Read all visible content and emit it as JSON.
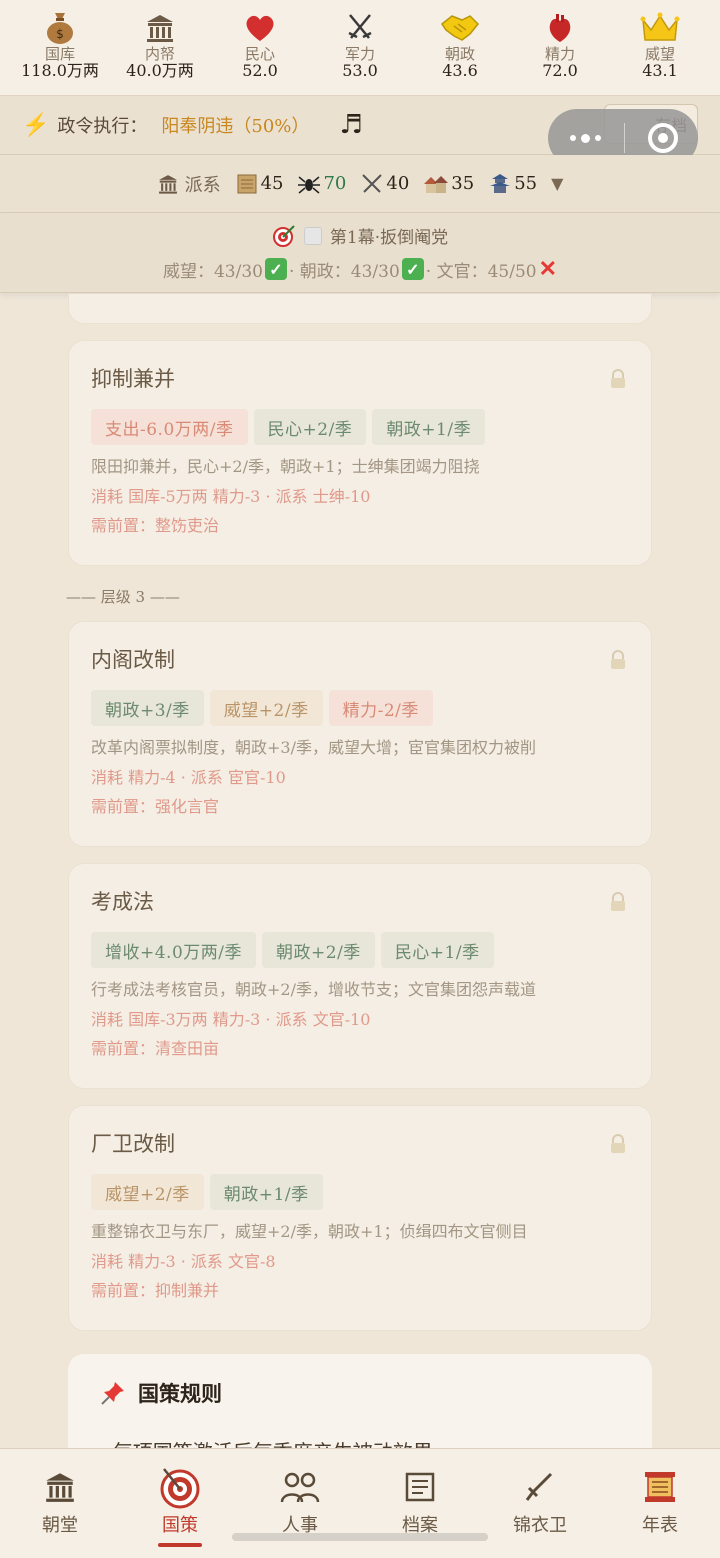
{
  "resources": [
    {
      "icon": "money-bag-icon",
      "label": "国库",
      "value": "118.0万两"
    },
    {
      "icon": "treasury-building-icon",
      "label": "内帑",
      "value": "40.0万两"
    },
    {
      "icon": "heart-icon",
      "label": "民心",
      "value": "52.0"
    },
    {
      "icon": "crossed-swords-icon",
      "label": "军力",
      "value": "53.0"
    },
    {
      "icon": "handshake-icon",
      "label": "朝政",
      "value": "43.6"
    },
    {
      "icon": "anatomical-heart-icon",
      "label": "精力",
      "value": "72.0"
    },
    {
      "icon": "crown-icon",
      "label": "威望",
      "value": "43.1"
    }
  ],
  "policy": {
    "label": "政令执行：",
    "value": "阳奉阴违（50%）",
    "save_label": "存档"
  },
  "factions": {
    "label": "派系",
    "items": [
      {
        "icon": "scroll-icon",
        "value": "45"
      },
      {
        "icon": "spider-icon",
        "value": "70"
      },
      {
        "icon": "crossed-swords-icon",
        "value": "40"
      },
      {
        "icon": "houses-icon",
        "value": "35"
      },
      {
        "icon": "pagoda-icon",
        "value": "55"
      }
    ],
    "toggle": "▼"
  },
  "act": {
    "title": "第1幕·扳倒阉党",
    "cond1": "威望：43/30",
    "cond2": "· 朝政：43/30",
    "cond3": "· 文官：45/50"
  },
  "tier_label": "—— 层级 3 ——",
  "cards": [
    {
      "title": "抑制兼并",
      "chips": [
        {
          "text": "支出-6.0万两/季",
          "tone": "red"
        },
        {
          "text": "民心+2/季",
          "tone": "green"
        },
        {
          "text": "朝政+1/季",
          "tone": "green"
        }
      ],
      "desc": "限田抑兼并，民心+2/季，朝政+1；士绅集团竭力阻挠",
      "cost": "消耗 国库-5万两 精力-3 · 派系 士绅-10",
      "pre": "需前置：整饬吏治"
    },
    {
      "title": "内阁改制",
      "chips": [
        {
          "text": "朝政+3/季",
          "tone": "green"
        },
        {
          "text": "威望+2/季",
          "tone": "gold"
        },
        {
          "text": "精力-2/季",
          "tone": "red"
        }
      ],
      "desc": "改革内阁票拟制度，朝政+3/季，威望大增；宦官集团权力被削",
      "cost": "消耗 精力-4 · 派系 宦官-10",
      "pre": "需前置：强化言官"
    },
    {
      "title": "考成法",
      "chips": [
        {
          "text": "增收+4.0万两/季",
          "tone": "green"
        },
        {
          "text": "朝政+2/季",
          "tone": "green"
        },
        {
          "text": "民心+1/季",
          "tone": "green"
        }
      ],
      "desc": "行考成法考核官员，朝政+2/季，增收节支；文官集团怨声载道",
      "cost": "消耗 国库-3万两 精力-3 · 派系 文官-10",
      "pre": "需前置：清查田亩"
    },
    {
      "title": "厂卫改制",
      "chips": [
        {
          "text": "威望+2/季",
          "tone": "gold"
        },
        {
          "text": "朝政+1/季",
          "tone": "green"
        }
      ],
      "desc": "重整锦衣卫与东厂，威望+2/季，朝政+1；侦缉四布文官侧目",
      "cost": "消耗 精力-3 · 派系 文官-8",
      "pre": "需前置：抑制兼并"
    }
  ],
  "rules": {
    "title": "国策规则",
    "line1": "· 每项国策激活后每季度产生被动效果"
  },
  "tabs": [
    {
      "label": "朝堂",
      "icon": "court-building-icon"
    },
    {
      "label": "国策",
      "icon": "target-icon"
    },
    {
      "label": "人事",
      "icon": "people-icon"
    },
    {
      "label": "档案",
      "icon": "document-icon"
    },
    {
      "label": "锦衣卫",
      "icon": "dagger-icon"
    },
    {
      "label": "年表",
      "icon": "scroll-timeline-icon"
    }
  ],
  "colors": {
    "accent": "#c0392b",
    "positive": "#6c8a6e",
    "negative": "#d98a76",
    "warning": "#c9871f"
  }
}
